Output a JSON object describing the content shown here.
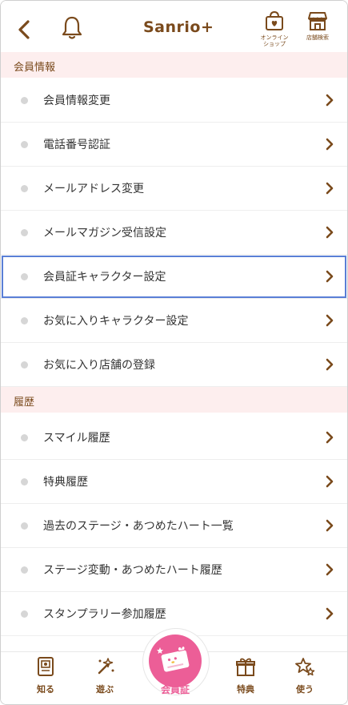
{
  "header": {
    "brand": "Sanrio+",
    "online_shop_label": "オンライン\nショップ",
    "store_search_label": "店舗検索"
  },
  "sections": [
    {
      "title": "会員情報",
      "items": [
        "会員情報変更",
        "電話番号認証",
        "メールアドレス変更",
        "メールマガジン受信設定",
        "会員証キャラクター設定",
        "お気に入りキャラクター設定",
        "お気に入り店舗の登録"
      ]
    },
    {
      "title": "履歴",
      "items": [
        "スマイル履歴",
        "特典履歴",
        "過去のステージ・あつめたハート一覧",
        "ステージ変動・あつめたハート履歴",
        "スタンプラリー参加履歴"
      ]
    }
  ],
  "highlighted_item": "会員証キャラクター設定",
  "tabbar": {
    "tabs": [
      {
        "label": "知る",
        "icon": "book-icon"
      },
      {
        "label": "遊ぶ",
        "icon": "magic-wand-icon"
      },
      {
        "label": "会員証",
        "icon": "member-card-icon"
      },
      {
        "label": "特典",
        "icon": "gift-icon"
      },
      {
        "label": "使う",
        "icon": "stars-icon"
      }
    ]
  },
  "colors": {
    "brand_brown": "#7a4a1c",
    "section_bg": "#fdeeee",
    "accent_pink": "#ec5e97",
    "highlight_blue": "#5a7fd6"
  }
}
